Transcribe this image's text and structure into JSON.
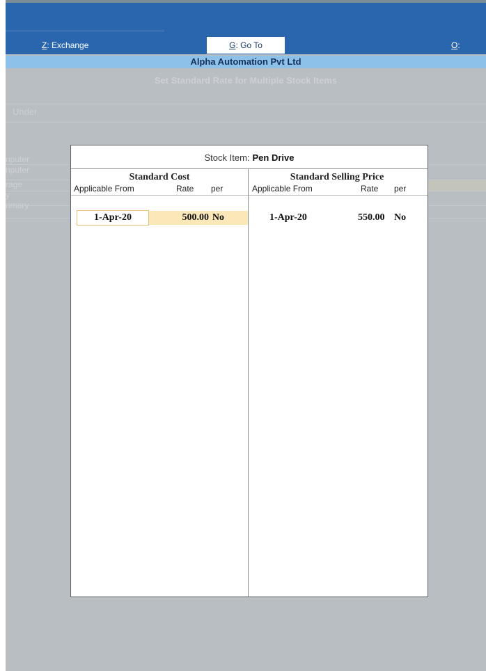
{
  "toolbar": {
    "exchange": {
      "key": "Z",
      "label": ": Exchange"
    },
    "goto": {
      "key": "G",
      "label": ": Go To"
    },
    "import": {
      "key": "O",
      "label": ": Import"
    }
  },
  "company_name": "Alpha Automation Pvt Ltd",
  "screen_title": "Set Standard Rate for Multiple Stock Items",
  "background": {
    "under_label": "Under",
    "rows": [
      "nputer",
      "nputer",
      "rage",
      "y",
      "rimary"
    ]
  },
  "popup": {
    "stock_item_label": "Stock Item:",
    "stock_item_value": "Pen Drive",
    "standard_cost": {
      "title": "Standard Cost",
      "headers": {
        "applicable_from": "Applicable From",
        "rate": "Rate",
        "per": "per"
      },
      "rows": [
        {
          "date": "1-Apr-20",
          "rate": "500.00",
          "per": "No"
        }
      ]
    },
    "standard_selling_price": {
      "title": "Standard Selling Price",
      "headers": {
        "applicable_from": "Applicable From",
        "rate": "Rate",
        "per": "per"
      },
      "rows": [
        {
          "date": "1-Apr-20",
          "rate": "550.00",
          "per": "No"
        }
      ]
    }
  },
  "colors": {
    "title_bar": "#2a66ad",
    "company_bar": "#8ec1ea",
    "background": "#b9bec3",
    "highlight": "#fbe7b8"
  }
}
